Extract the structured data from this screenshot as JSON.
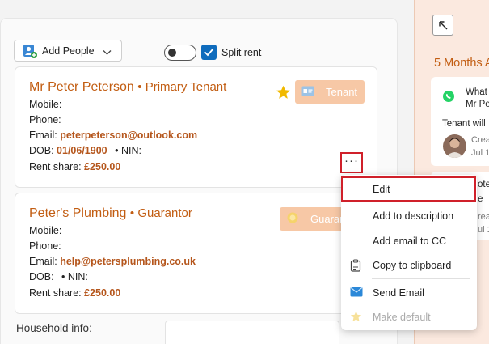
{
  "toolbar": {
    "add_people_label": "Add People",
    "split_rent_label": "Split rent",
    "split_rent_checked": true,
    "toggle_on": false
  },
  "people": [
    {
      "name": "Mr Peter Peterson",
      "role": "• Primary Tenant",
      "starred": true,
      "badge": "Tenant",
      "mobile_label": "Mobile:",
      "phone_label": "Phone:",
      "email_label": "Email:",
      "email": "peterpeterson@outlook.com",
      "dob_label": "DOB:",
      "dob": "01/06/1900",
      "nin_label": "• NIN:",
      "rent_label": "Rent share:",
      "rent": "£250.00"
    },
    {
      "name": "Peter's Plumbing",
      "role": "• Guarantor",
      "starred": false,
      "badge": "Guarantor",
      "mobile_label": "Mobile:",
      "phone_label": "Phone:",
      "email_label": "Email:",
      "email": "help@petersplumbing.co.uk",
      "dob_label": "DOB:",
      "dob": "",
      "nin_label": "• NIN:",
      "rent_label": "Rent share:",
      "rent": "£250.00"
    }
  ],
  "household_label": "Household info:",
  "more_button": "···",
  "context_menu": {
    "items": [
      {
        "label": "Edit",
        "icon": ""
      },
      {
        "label": "Add to description",
        "icon": ""
      },
      {
        "label": "Add email to CC",
        "icon": ""
      },
      {
        "label": "Copy to clipboard",
        "icon": "clipboard-icon"
      },
      {
        "label": "Send Email",
        "icon": "mail-icon"
      },
      {
        "label": "Make default",
        "icon": "star-icon",
        "disabled": true
      }
    ]
  },
  "activity": {
    "period": "5 Months A",
    "item1_title": "What",
    "item1_sub": "Mr Pe",
    "item1_text": "Tenant will",
    "item1_meta1": "Crea",
    "item1_meta2": "Jul 1",
    "item2_title": "ote",
    "item2_text": "e",
    "item2_meta1": "rea",
    "item2_meta2": "ul 1"
  },
  "colors": {
    "accent": "#c25d12",
    "badge": "#f7c8a6",
    "highlight": "#d0202a",
    "checkbox": "#0f6cbd"
  }
}
